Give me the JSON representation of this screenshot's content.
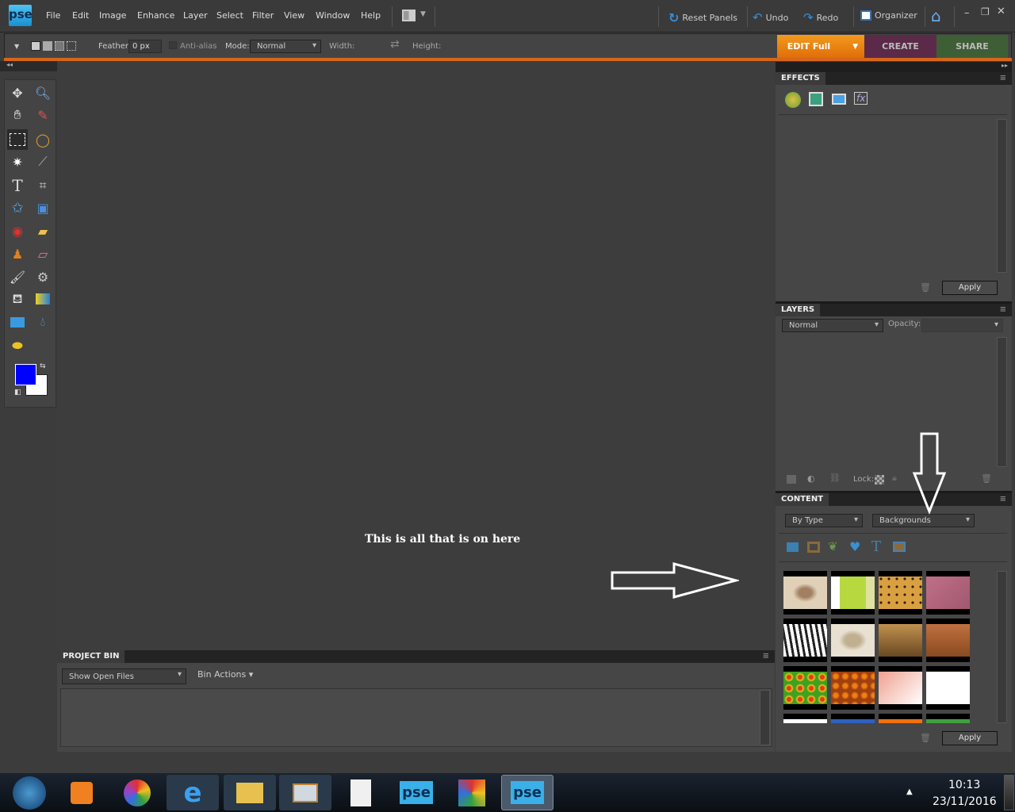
{
  "menubar": {
    "logo": "pse",
    "items": [
      "File",
      "Edit",
      "Image",
      "Enhance",
      "Layer",
      "Select",
      "Filter",
      "View",
      "Window",
      "Help"
    ],
    "reset_panels": "Reset Panels",
    "undo": "Undo",
    "redo": "Redo",
    "organizer": "Organizer"
  },
  "options": {
    "feather_label": "Feather:",
    "feather_value": "0 px",
    "antialias": "Anti-alias",
    "mode_label": "Mode:",
    "mode_value": "Normal",
    "width_label": "Width:",
    "height_label": "Height:"
  },
  "mode_tabs": {
    "edit": "EDIT Full",
    "create": "CREATE",
    "share": "SHARE"
  },
  "colors": {
    "orange": "#e8780f",
    "create": "#5b2a48",
    "share": "#3e5e35",
    "foreground": "#0000ff",
    "background": "#ffffff"
  },
  "canvas": {
    "annotation": "This is all that is on here"
  },
  "project_bin": {
    "title": "PROJECT BIN",
    "show": "Show Open Files",
    "actions": "Bin Actions"
  },
  "effects": {
    "title": "EFFECTS",
    "apply": "Apply"
  },
  "layers": {
    "title": "LAYERS",
    "blend": "Normal",
    "opacity_label": "Opacity:",
    "lock_label": "Lock:"
  },
  "content": {
    "title": "CONTENT",
    "filter": "By Type",
    "category": "Backgrounds",
    "apply": "Apply",
    "thumbnails": [
      "africa-map",
      "green-scrapbook",
      "leopard",
      "pink-texture",
      "zebra",
      "world-map",
      "grass-field",
      "autumn-field",
      "autumn-leaves",
      "orange-leaves",
      "peach-gradient",
      "white-floral",
      "white",
      "blue-floral",
      "orange",
      "green"
    ]
  },
  "taskbar": {
    "time": "10:13",
    "date": "23/11/2016",
    "apps": [
      "windows-start",
      "media-player",
      "picasa",
      "internet-explorer",
      "file-explorer",
      "mail",
      "document",
      "pse",
      "avg",
      "pse-active"
    ]
  }
}
